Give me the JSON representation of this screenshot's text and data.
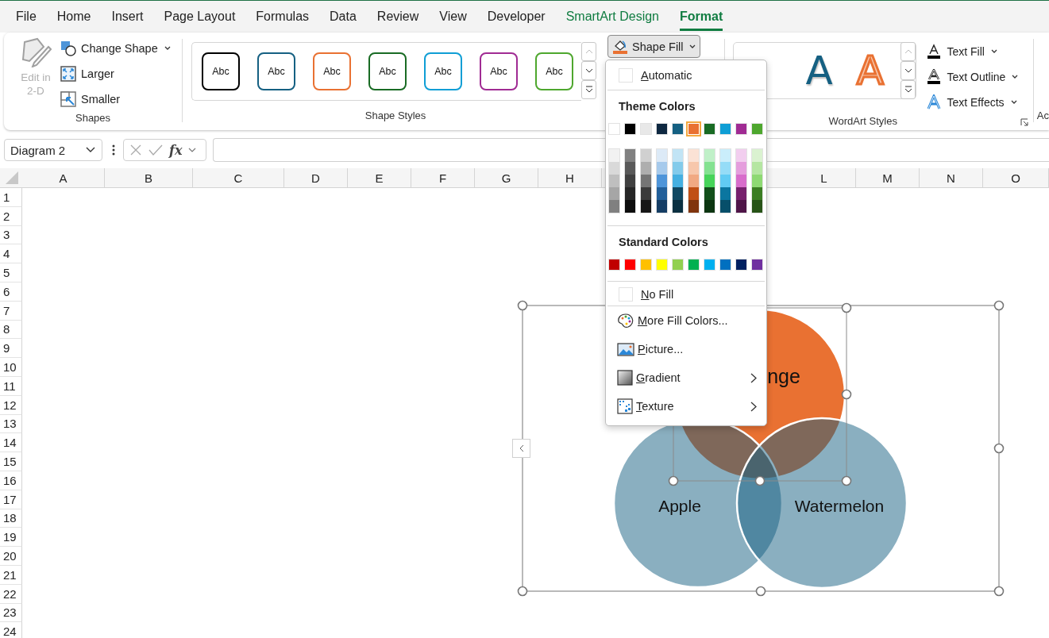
{
  "menu_tabs": [
    {
      "label": "File",
      "selected": false,
      "kind": "plain"
    },
    {
      "label": "Home",
      "selected": false,
      "kind": "plain"
    },
    {
      "label": "Insert",
      "selected": false,
      "kind": "plain"
    },
    {
      "label": "Page Layout",
      "selected": false,
      "kind": "plain"
    },
    {
      "label": "Formulas",
      "selected": false,
      "kind": "plain"
    },
    {
      "label": "Data",
      "selected": false,
      "kind": "plain"
    },
    {
      "label": "Review",
      "selected": false,
      "kind": "plain"
    },
    {
      "label": "View",
      "selected": false,
      "kind": "plain"
    },
    {
      "label": "Developer",
      "selected": false,
      "kind": "plain"
    },
    {
      "label": "SmartArt Design",
      "selected": false,
      "kind": "contextual"
    },
    {
      "label": "Format",
      "selected": true,
      "kind": "contextual"
    }
  ],
  "ribbon": {
    "shapes_group": {
      "label": "Shapes",
      "edit_button": {
        "label": "Edit in 2-D",
        "disabled": true
      },
      "commands": [
        {
          "label": "Change Shape",
          "dropdown": true
        },
        {
          "label": "Larger",
          "dropdown": false
        },
        {
          "label": "Smaller",
          "dropdown": false
        }
      ]
    },
    "shape_styles_group": {
      "label": "Shape Styles",
      "styles": [
        {
          "label": "Abc",
          "color": "#000000"
        },
        {
          "label": "Abc",
          "color": "#156082"
        },
        {
          "label": "Abc",
          "color": "#e97132"
        },
        {
          "label": "Abc",
          "color": "#196b24"
        },
        {
          "label": "Abc",
          "color": "#0f9ed5"
        },
        {
          "label": "Abc",
          "color": "#a02b93"
        },
        {
          "label": "Abc",
          "color": "#4ea72e"
        }
      ]
    },
    "shape_fill_button": {
      "label": "Shape Fill",
      "pressed": true
    },
    "wordart_group": {
      "label": "WordArt Styles",
      "styles": [
        {
          "text": "A",
          "kind": "fill"
        },
        {
          "text": "A",
          "kind": "outline"
        }
      ],
      "commands": [
        {
          "label": "Text Fill"
        },
        {
          "label": "Text Outline"
        },
        {
          "label": "Text Effects"
        }
      ]
    },
    "next_group_label": "Ac"
  },
  "formula_bar": {
    "name_box": "Diagram 2",
    "function_label": "fx"
  },
  "columns": [
    "A",
    "B",
    "C",
    "D",
    "E",
    "F",
    "G",
    "H",
    "L",
    "M",
    "N",
    "O"
  ],
  "rows": [
    "1",
    "2",
    "3",
    "4",
    "5",
    "6",
    "7",
    "8",
    "9",
    "10",
    "11",
    "12",
    "13",
    "14",
    "15",
    "16",
    "17",
    "18",
    "19",
    "20",
    "21",
    "22",
    "23",
    "24"
  ],
  "diagram": {
    "circles": [
      {
        "label": "nge",
        "kind": "accent"
      },
      {
        "label": "Apple",
        "kind": "translucent"
      },
      {
        "label": "Watermelon",
        "kind": "translucent"
      }
    ]
  },
  "shape_fill_menu": {
    "automatic": "Automatic",
    "theme_heading": "Theme Colors",
    "theme_colors": [
      {
        "color": "#ffffff",
        "selected": false
      },
      {
        "color": "#000000",
        "selected": false
      },
      {
        "color": "#e8e8e8",
        "selected": false
      },
      {
        "color": "#0e2841",
        "selected": false
      },
      {
        "color": "#156082",
        "selected": false
      },
      {
        "color": "#e97132",
        "selected": true
      },
      {
        "color": "#196b24",
        "selected": false
      },
      {
        "color": "#0f9ed5",
        "selected": false
      },
      {
        "color": "#a02b93",
        "selected": false
      },
      {
        "color": "#4ea72e",
        "selected": false
      }
    ],
    "theme_shades": [
      {
        "shades": [
          {
            "color": "#f2f2f2",
            "selected": false
          },
          {
            "color": "#d9d9d9",
            "selected": false
          },
          {
            "color": "#bfbfbf",
            "selected": false
          },
          {
            "color": "#a6a6a6",
            "selected": false
          },
          {
            "color": "#808080",
            "selected": false
          }
        ]
      },
      {
        "shades": [
          {
            "color": "#808080",
            "selected": false
          },
          {
            "color": "#595959",
            "selected": false
          },
          {
            "color": "#404040",
            "selected": false
          },
          {
            "color": "#262626",
            "selected": false
          },
          {
            "color": "#0d0d0d",
            "selected": false
          }
        ]
      },
      {
        "shades": [
          {
            "color": "#d0d0d0",
            "selected": false
          },
          {
            "color": "#aeaeae",
            "selected": false
          },
          {
            "color": "#757575",
            "selected": false
          },
          {
            "color": "#3a3a3a",
            "selected": false
          },
          {
            "color": "#171717",
            "selected": false
          }
        ]
      },
      {
        "shades": [
          {
            "color": "#dceaf7",
            "selected": false
          },
          {
            "color": "#a6caec",
            "selected": false
          },
          {
            "color": "#4e95d9",
            "selected": false
          },
          {
            "color": "#215f9a",
            "selected": false
          },
          {
            "color": "#153d64",
            "selected": false
          }
        ]
      },
      {
        "shades": [
          {
            "color": "#c1e4f5",
            "selected": false
          },
          {
            "color": "#83cbeb",
            "selected": false
          },
          {
            "color": "#45b0e1",
            "selected": false
          },
          {
            "color": "#104862",
            "selected": false
          },
          {
            "color": "#0b3041",
            "selected": false
          }
        ]
      },
      {
        "shades": [
          {
            "color": "#fbe2d5",
            "selected": false
          },
          {
            "color": "#f7c7ac",
            "selected": false
          },
          {
            "color": "#f1a983",
            "selected": false
          },
          {
            "color": "#c04f15",
            "selected": false
          },
          {
            "color": "#80350e",
            "selected": false
          }
        ]
      },
      {
        "shades": [
          {
            "color": "#c0f0c8",
            "selected": false
          },
          {
            "color": "#84e291",
            "selected": false
          },
          {
            "color": "#47d45a",
            "selected": false
          },
          {
            "color": "#124f1a",
            "selected": false
          },
          {
            "color": "#0c3511",
            "selected": false
          }
        ]
      },
      {
        "shades": [
          {
            "color": "#caeefb",
            "selected": false
          },
          {
            "color": "#95dcf7",
            "selected": false
          },
          {
            "color": "#61cbf3",
            "selected": false
          },
          {
            "color": "#0b76a0",
            "selected": false
          },
          {
            "color": "#074f6a",
            "selected": false
          }
        ]
      },
      {
        "shades": [
          {
            "color": "#f2ceef",
            "selected": false
          },
          {
            "color": "#e59edd",
            "selected": false
          },
          {
            "color": "#d86dcb",
            "selected": false
          },
          {
            "color": "#77206d",
            "selected": false
          },
          {
            "color": "#4f1548",
            "selected": false
          }
        ]
      },
      {
        "shades": [
          {
            "color": "#daf2d0",
            "selected": false
          },
          {
            "color": "#b5e6a2",
            "selected": false
          },
          {
            "color": "#8ed973",
            "selected": false
          },
          {
            "color": "#3b7d23",
            "selected": false
          },
          {
            "color": "#275317",
            "selected": false
          }
        ]
      }
    ],
    "standard_heading": "Standard Colors",
    "standard_colors": [
      {
        "color": "#c00000",
        "selected": false
      },
      {
        "color": "#ff0000",
        "selected": false
      },
      {
        "color": "#ffc000",
        "selected": false
      },
      {
        "color": "#ffff00",
        "selected": false
      },
      {
        "color": "#92d050",
        "selected": false
      },
      {
        "color": "#00b050",
        "selected": false
      },
      {
        "color": "#00b0f0",
        "selected": false
      },
      {
        "color": "#0070c0",
        "selected": false
      },
      {
        "color": "#002060",
        "selected": false
      },
      {
        "color": "#7030a0",
        "selected": false
      }
    ],
    "no_fill": "No Fill",
    "items": [
      {
        "label": "More Fill Colors...",
        "submenu": false,
        "kind": "palette"
      },
      {
        "label": "Picture...",
        "submenu": false,
        "kind": "picture"
      },
      {
        "label": "Gradient",
        "submenu": true,
        "kind": "gradient"
      },
      {
        "label": "Texture",
        "submenu": true,
        "kind": "texture"
      }
    ]
  }
}
